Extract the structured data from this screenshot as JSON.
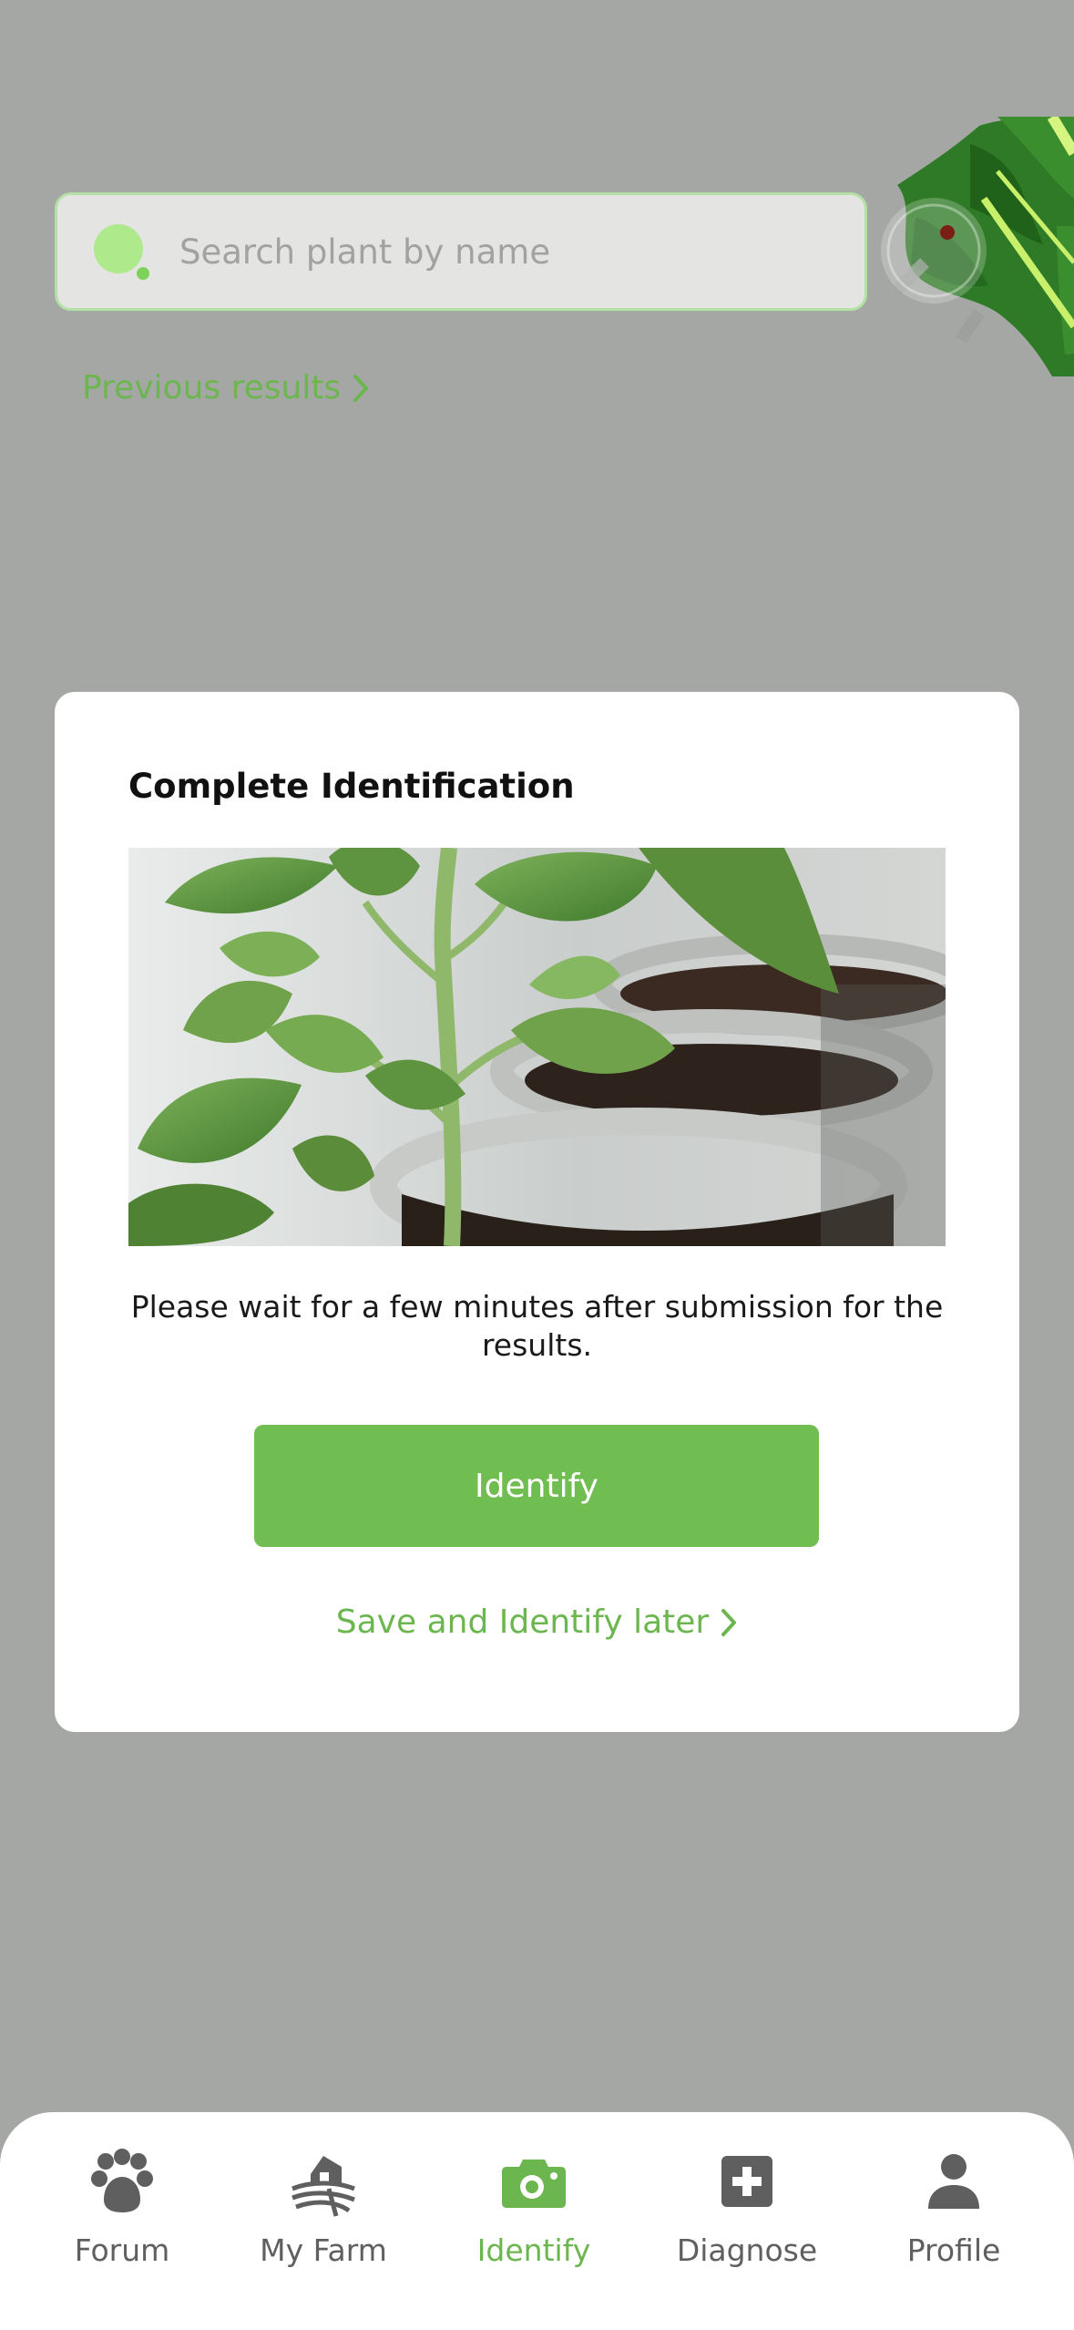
{
  "search": {
    "placeholder": "Search plant by name"
  },
  "previous_results": {
    "label": "Previous results"
  },
  "modal": {
    "title": "Complete Identification",
    "message": "Please wait for a few minutes after submission for the results.",
    "identify_label": "Identify",
    "save_later_label": "Save and Identify later"
  },
  "nav": {
    "items": [
      {
        "label": "Forum",
        "icon": "paw-icon"
      },
      {
        "label": "My Farm",
        "icon": "farm-icon"
      },
      {
        "label": "Identify",
        "icon": "camera-icon",
        "active": true
      },
      {
        "label": "Diagnose",
        "icon": "medical-plus-icon"
      },
      {
        "label": "Profile",
        "icon": "person-icon"
      }
    ]
  },
  "colors": {
    "accent": "#70BE52",
    "accent_text": "#6CB64F",
    "overlay": "#A5A7A5",
    "nav_inactive": "#5F5F5F"
  }
}
